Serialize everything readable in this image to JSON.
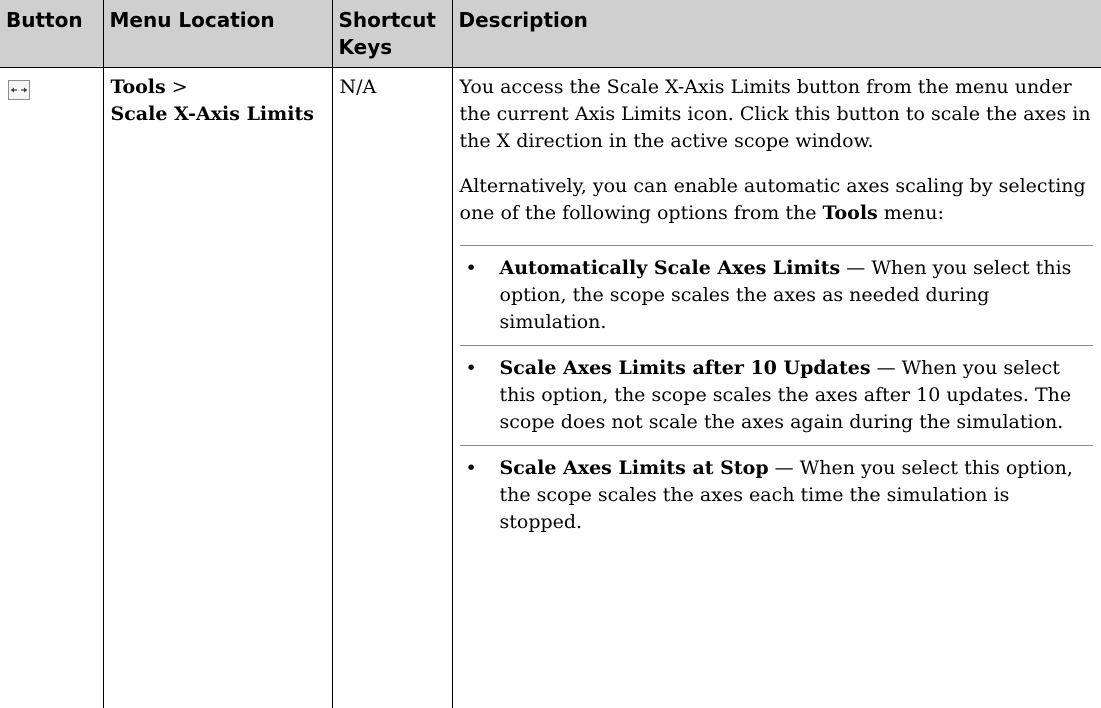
{
  "headers": {
    "button": "Button",
    "menu_location": "Menu Location",
    "shortcut_keys": "Shortcut Keys",
    "description": "Description"
  },
  "row": {
    "button_icon": "scale-x-axis-limits-icon",
    "menu_tools": "Tools",
    "menu_sep": ">",
    "menu_item": "Scale X-Axis Limits",
    "shortcut": "N/A",
    "para1": "You access the Scale X-Axis Limits button from the menu under the current Axis Limits icon. Click this button to scale the axes in the X direction in the active scope window.",
    "para2_before": "Alternatively, you can enable automatic axes scaling by selecting one of the following options from the ",
    "para2_bold": "Tools",
    "para2_after": " menu:",
    "bullet_glyph": "•",
    "bullets": [
      {
        "term": "Automatically Scale Axes Limits",
        "text": " — When you select this option, the scope scales the axes as needed during simulation."
      },
      {
        "term": "Scale Axes Limits after 10 Updates",
        "text": " — When you select this option, the scope scales the axes after 10 updates. The scope does not scale the axes again during the simulation."
      },
      {
        "term": "Scale Axes Limits at Stop",
        "text": " — When you select this option, the scope scales the axes each time the simulation is stopped."
      }
    ]
  },
  "colors": {
    "header_bg": "#cfcfcf",
    "border": "#000000",
    "bullet_divider": "#8a8a8a"
  }
}
